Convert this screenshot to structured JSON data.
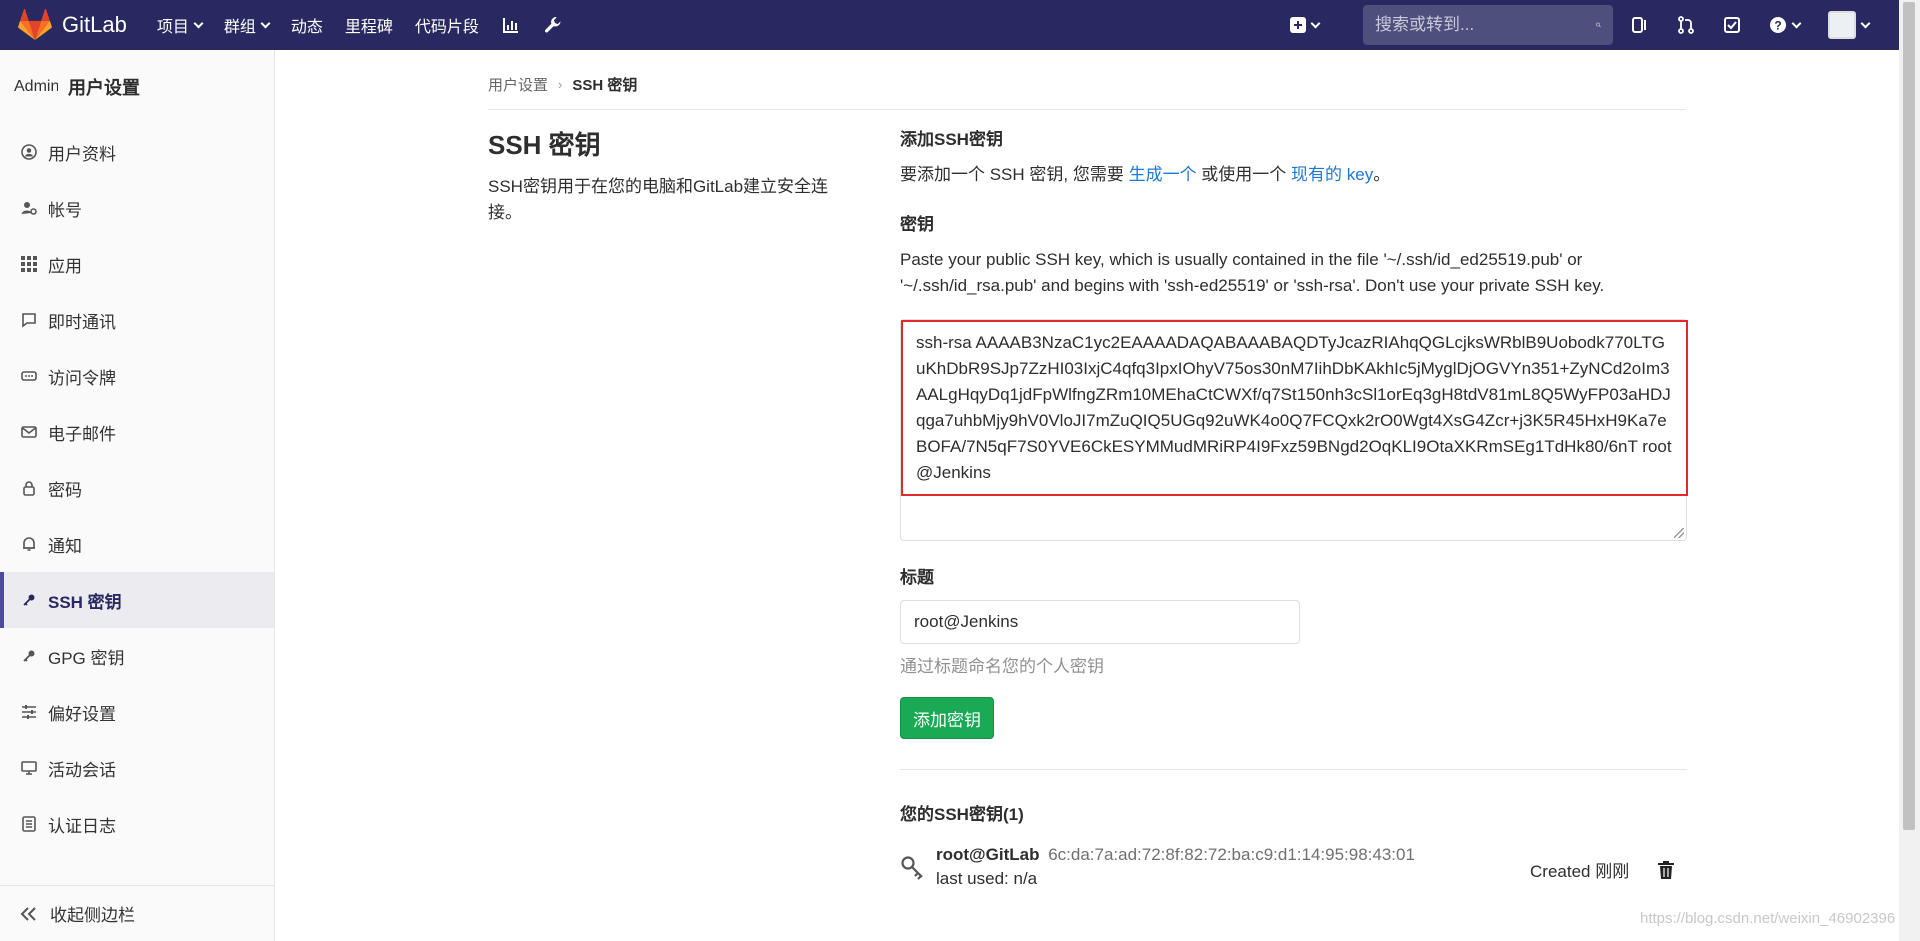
{
  "navbar": {
    "brand": "GitLab",
    "menu": [
      {
        "label": "项目",
        "dropdown": true
      },
      {
        "label": "群组",
        "dropdown": true
      },
      {
        "label": "动态",
        "dropdown": false
      },
      {
        "label": "里程碑",
        "dropdown": false
      },
      {
        "label": "代码片段",
        "dropdown": false
      }
    ],
    "icons": [
      "activity-chart-icon",
      "admin-wrench-icon"
    ],
    "search_placeholder": "搜索或转到...",
    "right_icons": [
      "plus-square-icon",
      "issues-icon",
      "merge-request-icon",
      "todo-check-icon",
      "help-icon",
      "user-avatar"
    ],
    "brand_color": "#292961"
  },
  "sidebar": {
    "avatar_alt": "Admin",
    "title": "用户设置",
    "items": [
      {
        "label": "用户资料",
        "icon": "user-profile-icon"
      },
      {
        "label": "帐号",
        "icon": "account-gear-icon"
      },
      {
        "label": "应用",
        "icon": "applications-grid-icon"
      },
      {
        "label": "即时通讯",
        "icon": "chat-bubble-icon"
      },
      {
        "label": "访问令牌",
        "icon": "token-icon"
      },
      {
        "label": "电子邮件",
        "icon": "mail-icon"
      },
      {
        "label": "密码",
        "icon": "lock-icon"
      },
      {
        "label": "通知",
        "icon": "bell-icon"
      },
      {
        "label": "SSH 密钥",
        "icon": "key-icon",
        "active": true
      },
      {
        "label": "GPG 密钥",
        "icon": "key-icon"
      },
      {
        "label": "偏好设置",
        "icon": "sliders-icon"
      },
      {
        "label": "活动会话",
        "icon": "monitor-icon"
      },
      {
        "label": "认证日志",
        "icon": "log-list-icon"
      }
    ],
    "collapse_label": "收起侧边栏"
  },
  "breadcrumb": {
    "parent": "用户设置",
    "current": "SSH 密钥"
  },
  "left": {
    "heading": "SSH 密钥",
    "description": "SSH密钥用于在您的电脑和GitLab建立安全连接。"
  },
  "form": {
    "add_heading": "添加SSH密钥",
    "intro_prefix": "要添加一个 SSH 密钥, 您需要 ",
    "intro_link1": "生成一个",
    "intro_mid": " 或使用一个 ",
    "intro_link2": "现有的 key",
    "intro_suffix": "。",
    "key_label": "密钥",
    "key_help": "Paste your public SSH key, which is usually contained in the file '~/.ssh/id_ed25519.pub' or '~/.ssh/id_rsa.pub' and begins with 'ssh-ed25519' or 'ssh-rsa'. Don't use your private SSH key.",
    "key_value": "ssh-rsa AAAAB3NzaC1yc2EAAAADAQABAAABAQDTyJcazRIAhqQGLcjksWRblB9Uobodk770LTGuKhDbR9SJp7ZzHI03IxjC4qfq3IpxIOhyV75os30nM7IihDbKAkhIc5jMyglDjOGVYn351+ZyNCd2oIm3AALgHqyDq1jdFpWlfngZRm10MEhaCtCWXf/q7St150nh3cSl1orEq3gH8tdV81mL8Q5WyFP03aHDJqga7uhbMjy9hV0VloJI7mZuQIQ5UGq92uWK4o0Q7FCQxk2rO0Wgt4XsG4Zcr+j3K5R45HxH9Ka7eBOFA/7N5qF7S0YVE6CkESYMMudMRiRP4I9Fxz59BNgd2OqKLI9OtaXKRmSEg1TdHk80/6nT root@Jenkins",
    "title_label": "标题",
    "title_value": "root@Jenkins",
    "title_help": "通过标题命名您的个人密钥",
    "submit_label": "添加密钥",
    "submit_color": "#1aaa55"
  },
  "keys": {
    "heading": "您的SSH密钥(1)",
    "list": [
      {
        "name": "root@GitLab",
        "fingerprint": "6c:da:7a:ad:72:8f:82:72:ba:c9:d1:14:95:98:43:01",
        "last_used": "last used: n/a",
        "created": "Created 刚刚"
      }
    ]
  },
  "watermark": "https://blog.csdn.net/weixin_46902396"
}
